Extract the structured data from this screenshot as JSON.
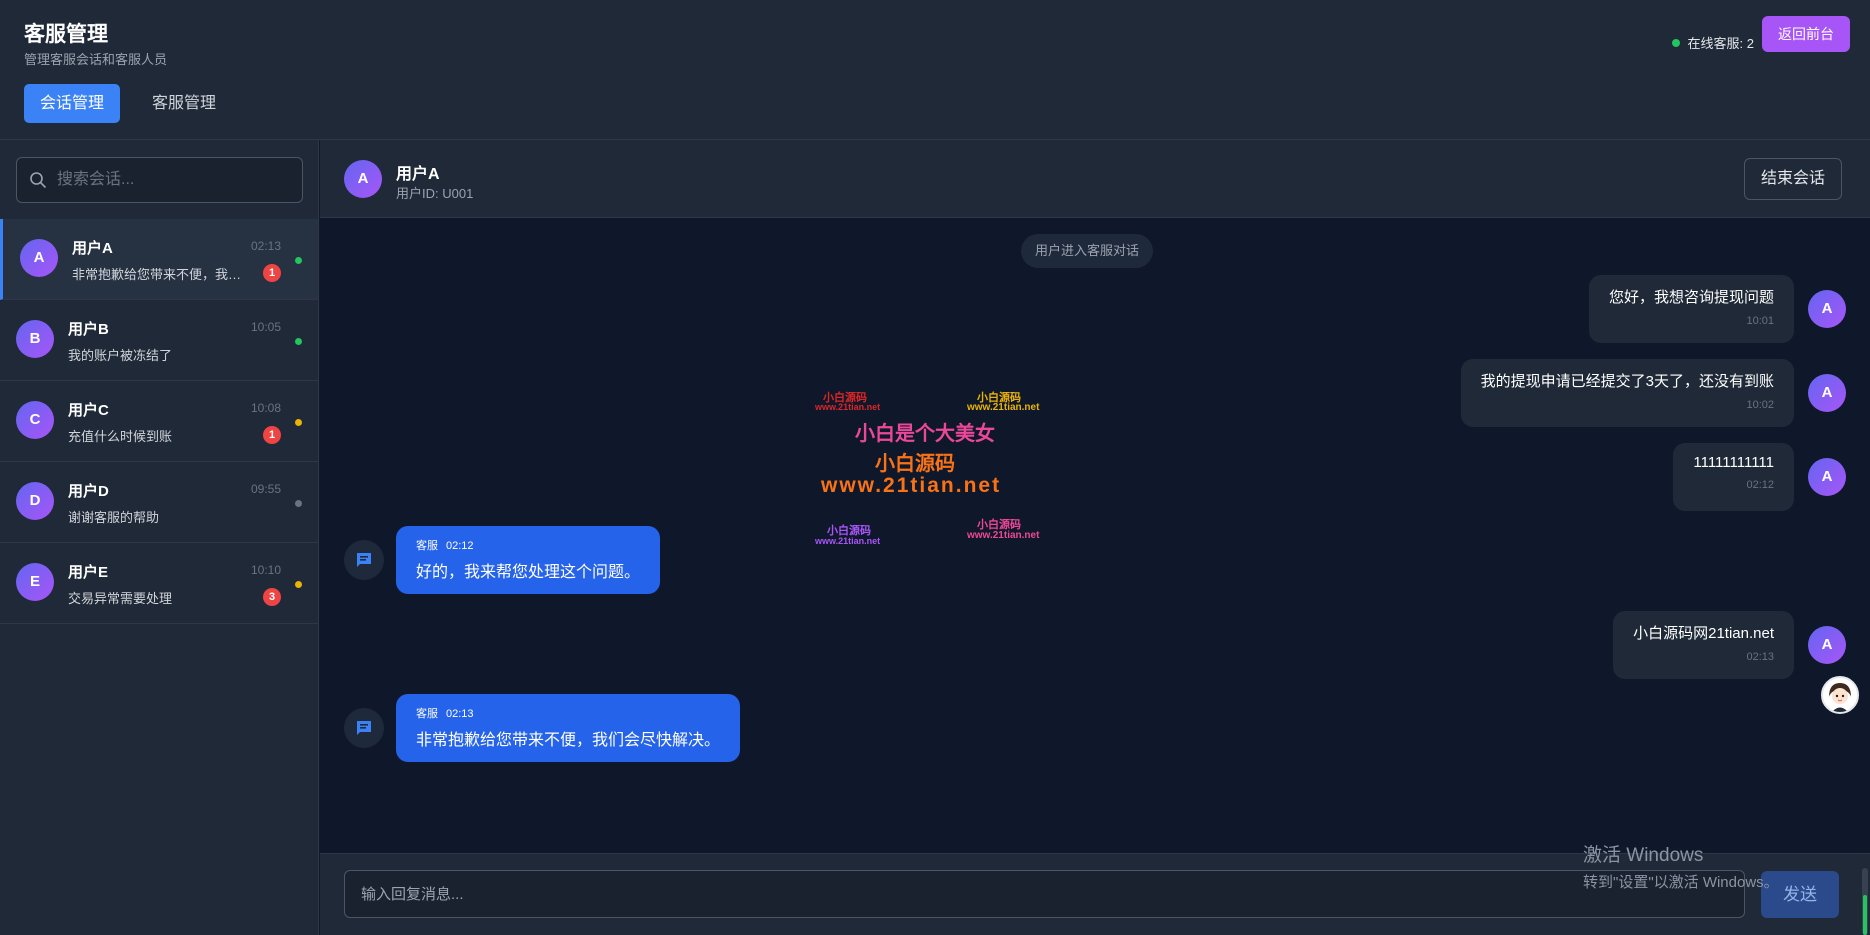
{
  "header": {
    "title": "客服管理",
    "subtitle": "管理客服会话和客服人员",
    "tabs": [
      {
        "label": "会话管理",
        "active": true
      },
      {
        "label": "客服管理",
        "active": false
      }
    ],
    "online_label": "在线客服: 2",
    "back_button": "返回前台"
  },
  "search": {
    "placeholder": "搜索会话..."
  },
  "conversations": [
    {
      "initial": "A",
      "name": "用户A",
      "time": "02:13",
      "preview": "非常抱歉给您带来不便，我们会尽快解决。",
      "unread": "1",
      "status_color": "#22c55e",
      "active": true
    },
    {
      "initial": "B",
      "name": "用户B",
      "time": "10:05",
      "preview": "我的账户被冻结了",
      "unread": "",
      "status_color": "#22c55e",
      "active": false
    },
    {
      "initial": "C",
      "name": "用户C",
      "time": "10:08",
      "preview": "充值什么时候到账",
      "unread": "1",
      "status_color": "#eab308",
      "active": false
    },
    {
      "initial": "D",
      "name": "用户D",
      "time": "09:55",
      "preview": "谢谢客服的帮助",
      "unread": "",
      "status_color": "#6b7280",
      "active": false
    },
    {
      "initial": "E",
      "name": "用户E",
      "time": "10:10",
      "preview": "交易异常需要处理",
      "unread": "3",
      "status_color": "#eab308",
      "active": false
    }
  ],
  "chat": {
    "user_initial": "A",
    "user_name": "用户A",
    "user_id": "用户ID: U001",
    "end_button": "结束会话",
    "system_message": "用户进入客服对话",
    "messages": [
      {
        "from": "user",
        "text": "您好，我想咨询提现问题",
        "time": "10:01"
      },
      {
        "from": "user",
        "text": "我的提现申请已经提交了3天了，还没有到账",
        "time": "10:02"
      },
      {
        "from": "user",
        "text": "11111111111",
        "time": "02:12"
      },
      {
        "from": "agent",
        "sender": "客服",
        "text": "好的，我来帮您处理这个问题。",
        "time": "02:12"
      },
      {
        "from": "user",
        "text": "小白源码网21tian.net",
        "time": "02:13"
      },
      {
        "from": "agent",
        "sender": "客服",
        "text": "非常抱歉给您带来不便，我们会尽快解决。",
        "time": "02:13"
      }
    ],
    "input_placeholder": "输入回复消息...",
    "send_button": "发送"
  },
  "watermark": {
    "small_1": "小白源码",
    "small_url_1": "www.21tian.net",
    "small_2": "小白源码",
    "small_url_2": "www.21tian.net",
    "main": "小白是个大美女",
    "brand": "小白源码",
    "url": "www.21tian.net",
    "small_3": "小白源码",
    "small_url_3": "www.21tian.net",
    "small_4": "小白源码",
    "small_url_4": "www.21tian.net"
  },
  "os_watermark": {
    "line1": "激活 Windows",
    "line2": "转到\"设置\"以激活 Windows。"
  },
  "colors": {
    "primary": "#3b82f6",
    "accent_purple": "#a855f7",
    "agent_bubble": "#2563eb",
    "online_green": "#22c55e",
    "badge_red": "#ef4444",
    "away_yellow": "#eab308"
  }
}
